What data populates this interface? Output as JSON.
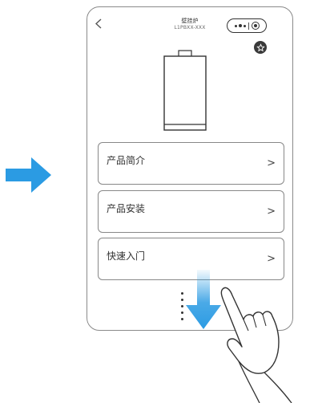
{
  "header": {
    "back_icon": "chevron-left-icon",
    "title": "壁挂炉",
    "subtitle": "L1PBXX-XXX"
  },
  "capsule": {
    "menu_icon": "more-dots-icon",
    "close_icon": "target-circle-icon"
  },
  "favorite_icon": "star-icon",
  "device_image": "boiler-device-image",
  "menu": [
    {
      "label": "产品简介",
      "chevron": ">"
    },
    {
      "label": "产品安装",
      "chevron": ">"
    },
    {
      "label": "快速入门",
      "chevron": ">"
    }
  ],
  "overlay": {
    "left_arrow_color": "#2b9be3",
    "down_arrow_color": "#2b9be3",
    "gesture": "swipe-down-hand-icon"
  }
}
